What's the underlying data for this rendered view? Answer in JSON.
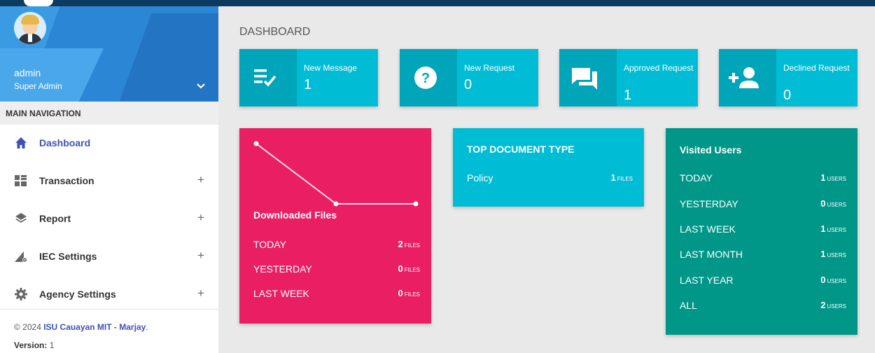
{
  "sidebar": {
    "user": {
      "name": "admin",
      "role": "Super Admin"
    },
    "nav_header": "MAIN NAVIGATION",
    "items": [
      {
        "label": "Dashboard",
        "icon": "home-icon"
      },
      {
        "label": "Transaction",
        "icon": "grid-icon",
        "expand": "+"
      },
      {
        "label": "Report",
        "icon": "layers-icon",
        "expand": "+"
      },
      {
        "label": "IEC Settings",
        "icon": "signal-settings-icon",
        "expand": "+"
      },
      {
        "label": "Agency Settings",
        "icon": "gear-icon",
        "expand": "+"
      }
    ],
    "footer": {
      "copyright": "© 2024 ",
      "link": "ISU Cauayan MIT - Marjay",
      "period": ".",
      "version_label": "Version:",
      "version_value": " 1"
    }
  },
  "main": {
    "page_title": "DASHBOARD",
    "info_boxes": [
      {
        "label": "New Message",
        "value": "1",
        "icon": "playlist-check-icon"
      },
      {
        "label": "New Request",
        "value": "0",
        "icon": "help-icon"
      },
      {
        "label": "Approved Request",
        "value": "1",
        "icon": "forum-icon"
      },
      {
        "label": "Declined Request",
        "value": "0",
        "icon": "person-add-icon"
      }
    ],
    "downloaded": {
      "title": "Downloaded Files",
      "unit": "FILES",
      "rows": [
        {
          "label": "TODAY",
          "value": "2"
        },
        {
          "label": "YESTERDAY",
          "value": "0"
        },
        {
          "label": "LAST WEEK",
          "value": "0"
        }
      ]
    },
    "top_doc": {
      "title": "TOP DOCUMENT TYPE",
      "unit": "FILES",
      "rows": [
        {
          "label": "Policy",
          "value": "1"
        }
      ]
    },
    "visited": {
      "title": "Visited Users",
      "unit": "USERS",
      "rows": [
        {
          "label": "TODAY",
          "value": "1"
        },
        {
          "label": "YESTERDAY",
          "value": "0"
        },
        {
          "label": "LAST WEEK",
          "value": "1"
        },
        {
          "label": "LAST MONTH",
          "value": "1"
        },
        {
          "label": "LAST YEAR",
          "value": "0"
        },
        {
          "label": "ALL",
          "value": "2"
        }
      ]
    }
  },
  "colors": {
    "pink": "#e91e63",
    "cyan": "#00bcd4",
    "teal": "#009688",
    "nav_active": "#3f51b5"
  },
  "chart_data": {
    "type": "line",
    "x": [
      1,
      2,
      3
    ],
    "values": [
      2,
      0,
      0
    ]
  }
}
